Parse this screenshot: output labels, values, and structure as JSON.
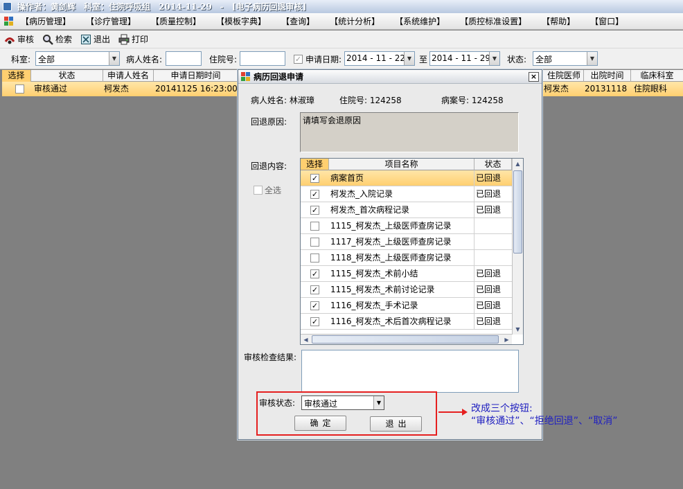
{
  "window": {
    "title_operator": "操作者：黄剑辉",
    "title_dept": "科室：住院呼吸组",
    "title_date": "2014-11-29",
    "title_sep": "-",
    "title_module": "[电子病历回退审核]"
  },
  "menu": [
    {
      "label": "【病历管理】"
    },
    {
      "label": "【诊疗管理】"
    },
    {
      "label": "【质量控制】"
    },
    {
      "label": "【模板字典】"
    },
    {
      "label": "【查询】"
    },
    {
      "label": "【统计分析】"
    },
    {
      "label": "【系统维护】"
    },
    {
      "label": "【质控标准设置】"
    },
    {
      "label": "【帮助】"
    },
    {
      "label": "【窗口】"
    }
  ],
  "toolbar": {
    "audit": "审核",
    "search": "检索",
    "exit": "退出",
    "print": "打印"
  },
  "filter": {
    "dept_label": "科室:",
    "dept_value": "全部",
    "patient_label": "病人姓名:",
    "patient_value": "",
    "inpatient_label": "住院号:",
    "inpatient_value": "",
    "date_label": "申请日期:",
    "date_from": "2014 - 11 - 22",
    "to_label": "至",
    "date_to": "2014 - 11 - 29",
    "status_label": "状态:",
    "status_value": "全部"
  },
  "grid": {
    "headers": {
      "select": "选择",
      "status": "状态",
      "applicant": "申请人姓名",
      "datetime": "申请日期时间",
      "doctor": "住院医师",
      "discharge": "出院时间",
      "clinic": "临床科室"
    },
    "row": {
      "status": "审核通过",
      "applicant": "柯发杰",
      "datetime": "20141125 16:23:00",
      "doctor": "柯发杰",
      "discharge": "20131118",
      "clinic": "住院眼科"
    }
  },
  "dialog": {
    "title": "病历回退申请",
    "close": "×",
    "patient_name": "病人姓名: 林淑璋",
    "inpatient_no": "住院号: 124258",
    "case_no": "病案号: 124258",
    "reason_label": "回退原因:",
    "reason_placeholder": "请填写会退原因",
    "content_label": "回退内容:",
    "select_all": "全选",
    "table_headers": {
      "select": "选择",
      "name": "项目名称",
      "status": "状态"
    },
    "items": [
      {
        "checked": true,
        "name": "病案首页",
        "status": "已回退"
      },
      {
        "checked": true,
        "name": "柯发杰_入院记录",
        "status": "已回退"
      },
      {
        "checked": true,
        "name": "柯发杰_首次病程记录",
        "status": "已回退"
      },
      {
        "checked": false,
        "name": "1115_柯发杰_上级医师查房记录",
        "status": ""
      },
      {
        "checked": false,
        "name": "1117_柯发杰_上级医师查房记录",
        "status": ""
      },
      {
        "checked": false,
        "name": "1118_柯发杰_上级医师查房记录",
        "status": ""
      },
      {
        "checked": true,
        "name": "1115_柯发杰_术前小结",
        "status": "已回退"
      },
      {
        "checked": true,
        "name": "1115_柯发杰_术前讨论记录",
        "status": "已回退"
      },
      {
        "checked": true,
        "name": "1116_柯发杰_手术记录",
        "status": "已回退"
      },
      {
        "checked": true,
        "name": "1116_柯发杰_术后首次病程记录",
        "status": "已回退"
      }
    ],
    "result_label": "审核检查结果:",
    "audit_status_label": "审核状态:",
    "audit_status_value": "审核通过",
    "confirm": "确定",
    "exit": "退出"
  },
  "annotation": {
    "line1": "改成三个按钮:",
    "line2": "“审核通过”、“拒绝回退”、“取消”"
  },
  "colors": {
    "selection": "#ffcf70",
    "annotation_red": "#e51f1f",
    "annotation_text": "#2020c0"
  }
}
